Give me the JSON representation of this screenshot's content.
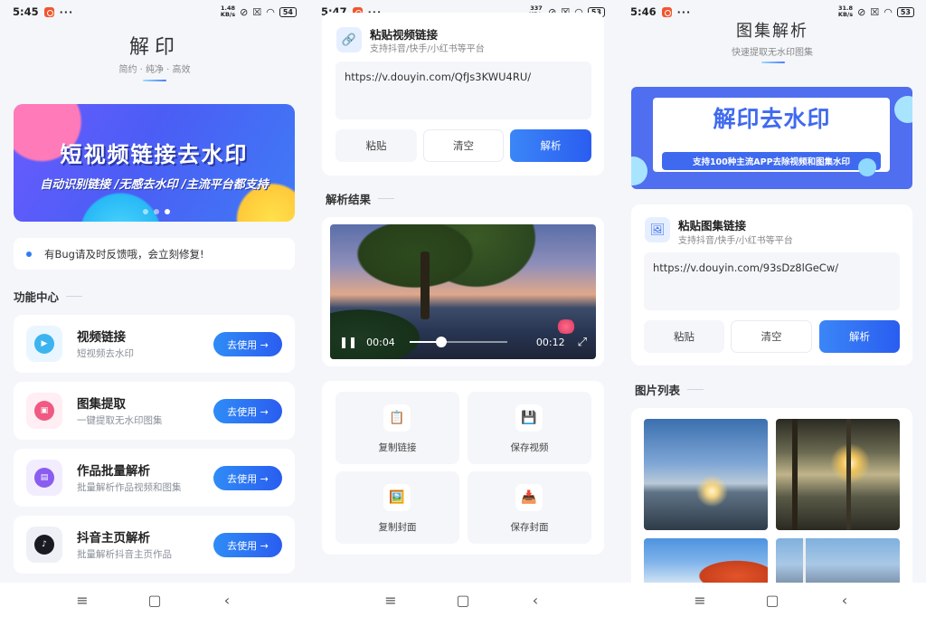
{
  "status_bars": [
    {
      "time": "5:45",
      "dots": "···",
      "speed": "1.48\nKB/s",
      "battery": "54"
    },
    {
      "time": "5:47",
      "dots": "···",
      "speed": "337\nKB/s",
      "battery": "53"
    },
    {
      "time": "5:46",
      "dots": "···",
      "speed": "31.8\nKB/s",
      "battery": "53"
    }
  ],
  "home": {
    "title": "解印",
    "subtitle": "简约 · 纯净 · 高效",
    "banner": {
      "headline": "短视频链接去水印",
      "tagline": "自动识别链接 /无感去水印 /主流平台都支持"
    },
    "notice": "有Bug请及时反馈哦，会立刻修复!",
    "section_title": "功能中心",
    "features": [
      {
        "title": "视频链接",
        "desc": "短视频去水印",
        "button": "去使用 →",
        "icon": "video-play-icon",
        "color": "#3cb4f0"
      },
      {
        "title": "图集提取",
        "desc": "一键提取无水印图集",
        "button": "去使用 →",
        "icon": "image-icon",
        "color": "#f05a82"
      },
      {
        "title": "作品批量解析",
        "desc": "批量解析作品视频和图集",
        "button": "去使用 →",
        "icon": "batch-icon",
        "color": "#8a5cf0"
      },
      {
        "title": "抖音主页解析",
        "desc": "批量解析抖音主页作品",
        "button": "去使用 →",
        "icon": "tiktok-icon",
        "color": "#1a1a22"
      }
    ]
  },
  "video_parse": {
    "card_title": "粘贴视频链接",
    "card_sub": "支持抖音/快手/小红书等平台",
    "url": "https://v.douyin.com/QfJs3KWU4RU/",
    "buttons": {
      "paste": "粘贴",
      "clear": "清空",
      "parse": "解析"
    },
    "result_title": "解析结果",
    "player": {
      "current": "00:04",
      "duration": "00:12",
      "progress": 0.33
    },
    "actions": [
      {
        "label": "复制链接",
        "icon": "📋"
      },
      {
        "label": "保存视频",
        "icon": "💾"
      },
      {
        "label": "复制封面",
        "icon": "🖼️"
      },
      {
        "label": "保存封面",
        "icon": "📥"
      }
    ]
  },
  "gallery_parse": {
    "title": "图集解析",
    "subtitle": "快速提取无水印图集",
    "banner": {
      "headline": "解印去水印",
      "tagline": "支持100种主流APP去除视频和图集水印"
    },
    "card_title": "粘贴图集链接",
    "card_sub": "支持抖音/快手/小红书等平台",
    "url": "https://v.douyin.com/93sDz8lGeCw/",
    "buttons": {
      "paste": "粘贴",
      "clear": "清空",
      "parse": "解析"
    },
    "list_title": "图片列表"
  },
  "navbar": {
    "menu": "≡",
    "home": "▢",
    "back": "‹"
  }
}
